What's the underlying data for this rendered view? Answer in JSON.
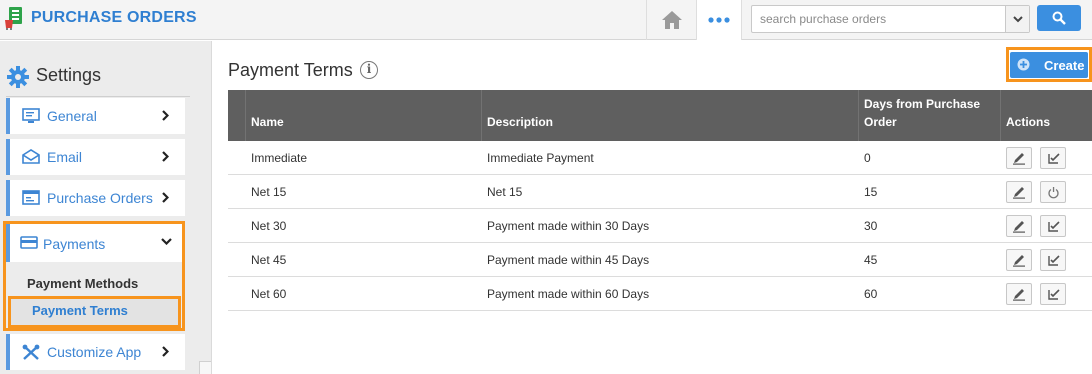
{
  "header": {
    "app_title": "PURCHASE ORDERS",
    "search_placeholder": "search purchase orders"
  },
  "sidebar": {
    "title": "Settings",
    "items": [
      {
        "label": "General"
      },
      {
        "label": "Email"
      },
      {
        "label": "Purchase Orders"
      },
      {
        "label": "Payments"
      },
      {
        "label": "Customize App"
      }
    ],
    "payments_sub": [
      {
        "label": "Payment Methods"
      },
      {
        "label": "Payment Terms"
      }
    ]
  },
  "main": {
    "title": "Payment Terms",
    "info_glyph": "i",
    "create_label": "Create",
    "columns": [
      "Name",
      "Description",
      "Days from Purchase Order",
      "Actions"
    ],
    "rows": [
      {
        "name": "Immediate",
        "description": "Immediate Payment",
        "days": "0",
        "second_action": "edit-check-icon"
      },
      {
        "name": "Net 15",
        "description": "Net 15",
        "days": "15",
        "second_action": "power-icon"
      },
      {
        "name": "Net 30",
        "description": "Payment made within 30 Days",
        "days": "30",
        "second_action": "edit-check-icon"
      },
      {
        "name": "Net 45",
        "description": "Payment made within 45 Days",
        "days": "45",
        "second_action": "edit-check-icon"
      },
      {
        "name": "Net 60",
        "description": "Payment made within 60 Days",
        "days": "60",
        "second_action": "edit-check-icon"
      }
    ]
  },
  "colors": {
    "brand_blue": "#2f7fd1",
    "button_blue": "#3b8fe0",
    "highlight_orange": "#f7941d",
    "table_header": "#5f5f5f"
  }
}
